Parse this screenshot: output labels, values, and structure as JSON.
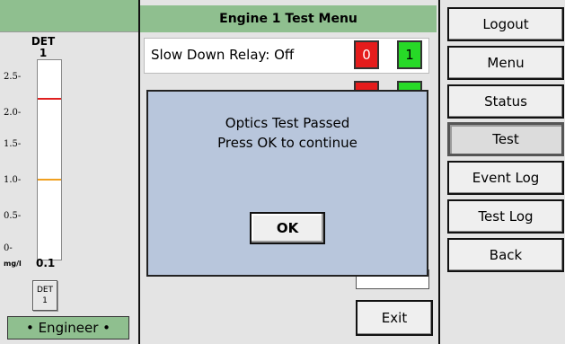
{
  "left_panel": {
    "detector_title": "DET",
    "detector_number": "1",
    "gauge": {
      "ticks": [
        "2.5-",
        "2.0-",
        "1.5-",
        "1.0-",
        "0.5-",
        "0-"
      ],
      "unit": "mg/l",
      "value": "0.1",
      "alarm_high_value": 2.2,
      "alarm_low_value": 1.1,
      "alarm_high_color": "#e02020",
      "alarm_low_color": "#f0a020"
    },
    "detector_button_line1": "DET",
    "detector_button_line2": "1",
    "user_level": "• Engineer •"
  },
  "center": {
    "header": "Engine 1 Test Menu",
    "row1_label": "Slow Down Relay:  Off",
    "off_button": "0",
    "on_button": "1",
    "exit_label": "Exit"
  },
  "dialog": {
    "line1": "Optics Test Passed",
    "line2": "Press OK to continue",
    "ok_label": "OK"
  },
  "nav": [
    {
      "label": "Logout"
    },
    {
      "label": "Menu"
    },
    {
      "label": "Status"
    },
    {
      "label": "Test",
      "active": true
    },
    {
      "label": "Event Log"
    },
    {
      "label": "Test Log"
    },
    {
      "label": "Back"
    }
  ],
  "colors": {
    "header_green": "#8fbf8f",
    "off_red": "#e51c1c",
    "on_green": "#27d927",
    "dialog_blue": "#b8c6dc"
  }
}
